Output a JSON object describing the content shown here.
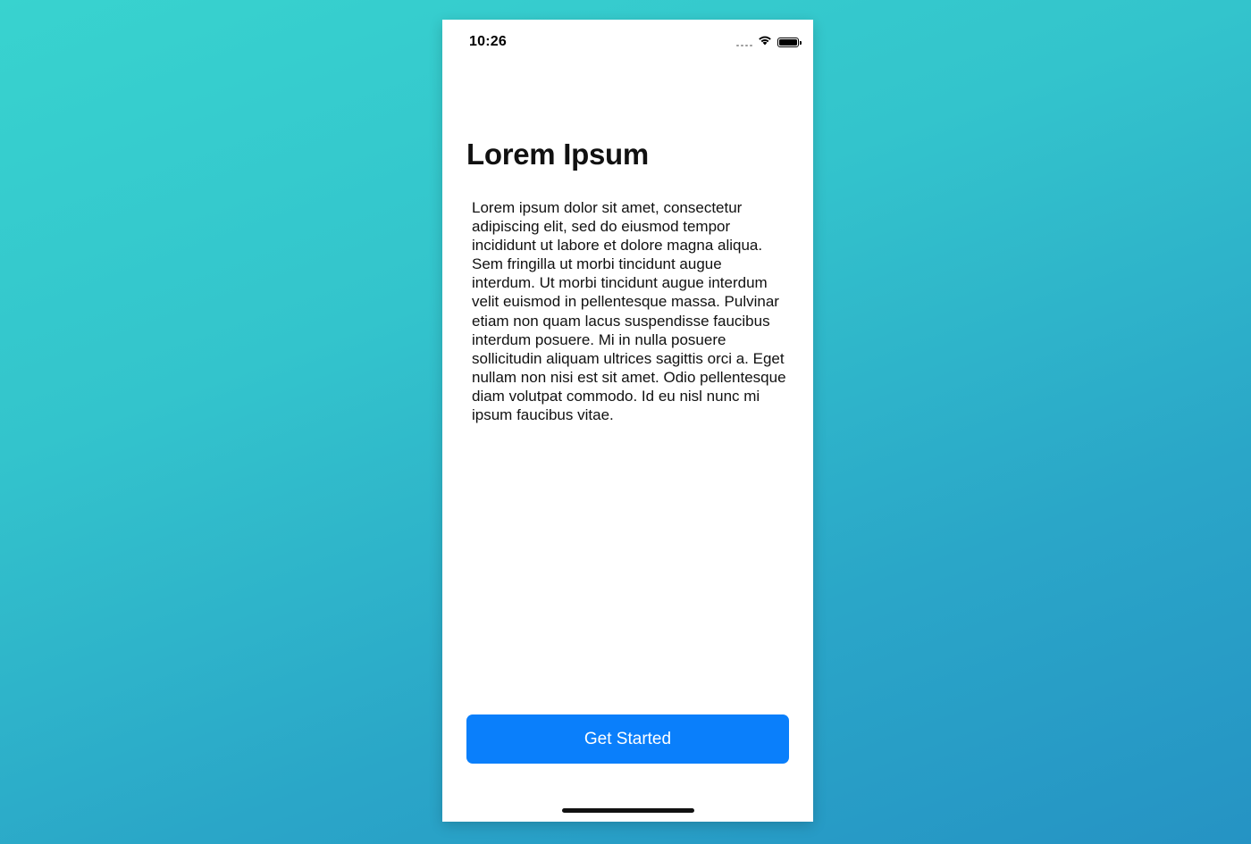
{
  "status_bar": {
    "time": "10:26",
    "icons": [
      "cellular-signal-icon",
      "wifi-icon",
      "battery-icon"
    ]
  },
  "content": {
    "title": "Lorem Ipsum",
    "body": "Lorem ipsum dolor sit amet, consectetur adipiscing elit, sed do eiusmod tempor incididunt ut labore et dolore magna aliqua. Sem fringilla ut morbi tincidunt augue interdum. Ut morbi tincidunt augue interdum velit euismod in pellentesque massa. Pulvinar etiam non quam lacus suspendisse faucibus interdum posuere. Mi in nulla posuere sollicitudin aliquam ultrices sagittis orci a. Eget nullam non nisi est sit amet. Odio pellentesque diam volutpat commodo. Id eu nisl nunc mi ipsum faucibus vitae."
  },
  "cta": {
    "label": "Get Started"
  },
  "colors": {
    "background_gradient_start": "#38d3cf",
    "background_gradient_end": "#2593c4",
    "button": "#0a7ffb",
    "button_text": "#ffffff",
    "screen": "#ffffff"
  }
}
